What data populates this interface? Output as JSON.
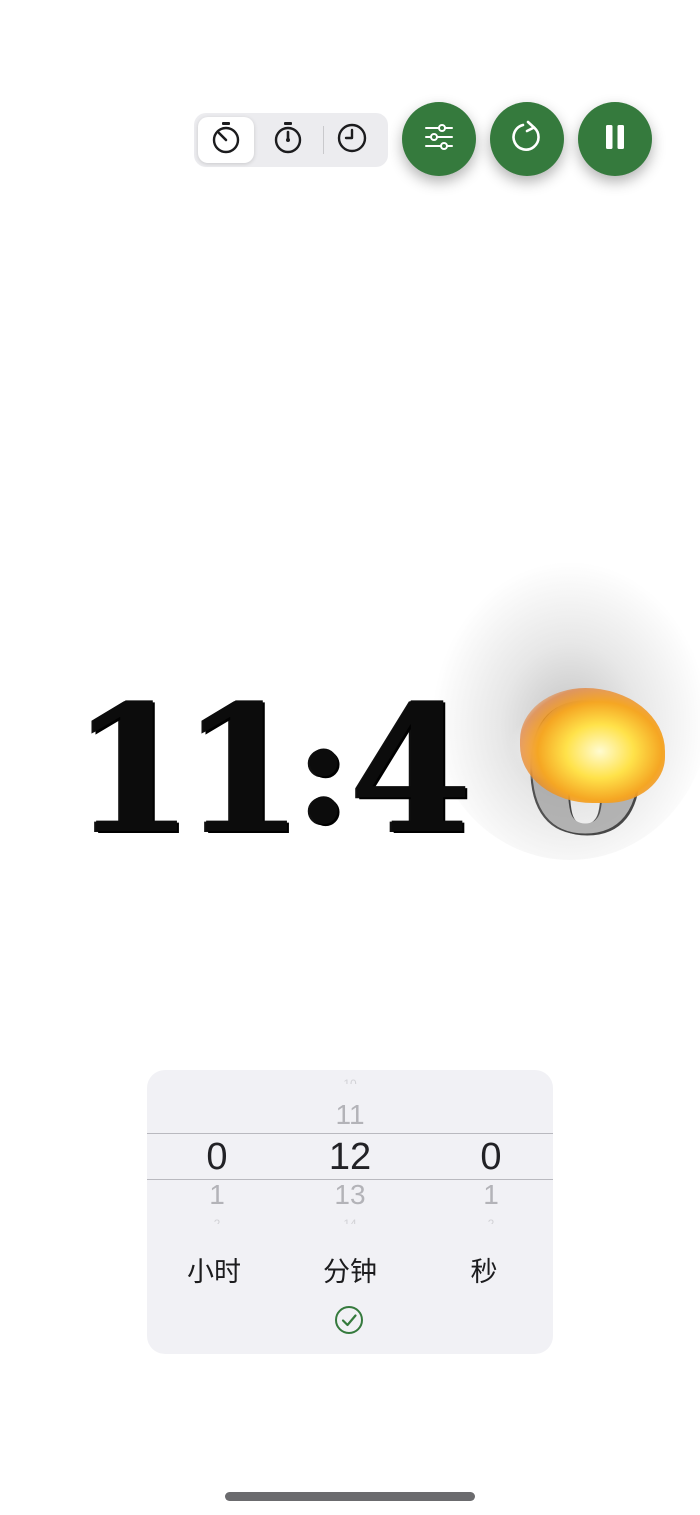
{
  "toolbar": {
    "modes": [
      {
        "icon": "timer-icon",
        "active": true
      },
      {
        "icon": "stopwatch-icon",
        "active": false
      },
      {
        "icon": "clock-icon",
        "active": false
      }
    ],
    "actions": [
      {
        "icon": "sliders-icon"
      },
      {
        "icon": "restart-icon"
      },
      {
        "icon": "pause-icon"
      }
    ],
    "accent_color": "#357a3d"
  },
  "time_display": {
    "d1": "1",
    "d2": "1",
    "colon": ":",
    "d3": "4",
    "d4": "0",
    "effect": "burning-digit"
  },
  "picker": {
    "hours": {
      "above": "",
      "selected": "0",
      "below": "1",
      "unit": "小时"
    },
    "minutes": {
      "above": "11",
      "selected": "12",
      "below": "13",
      "unit": "分钟"
    },
    "seconds": {
      "above": "",
      "selected": "0",
      "below": "1",
      "unit": "秒"
    },
    "confirm_icon": "check-circle-icon"
  }
}
